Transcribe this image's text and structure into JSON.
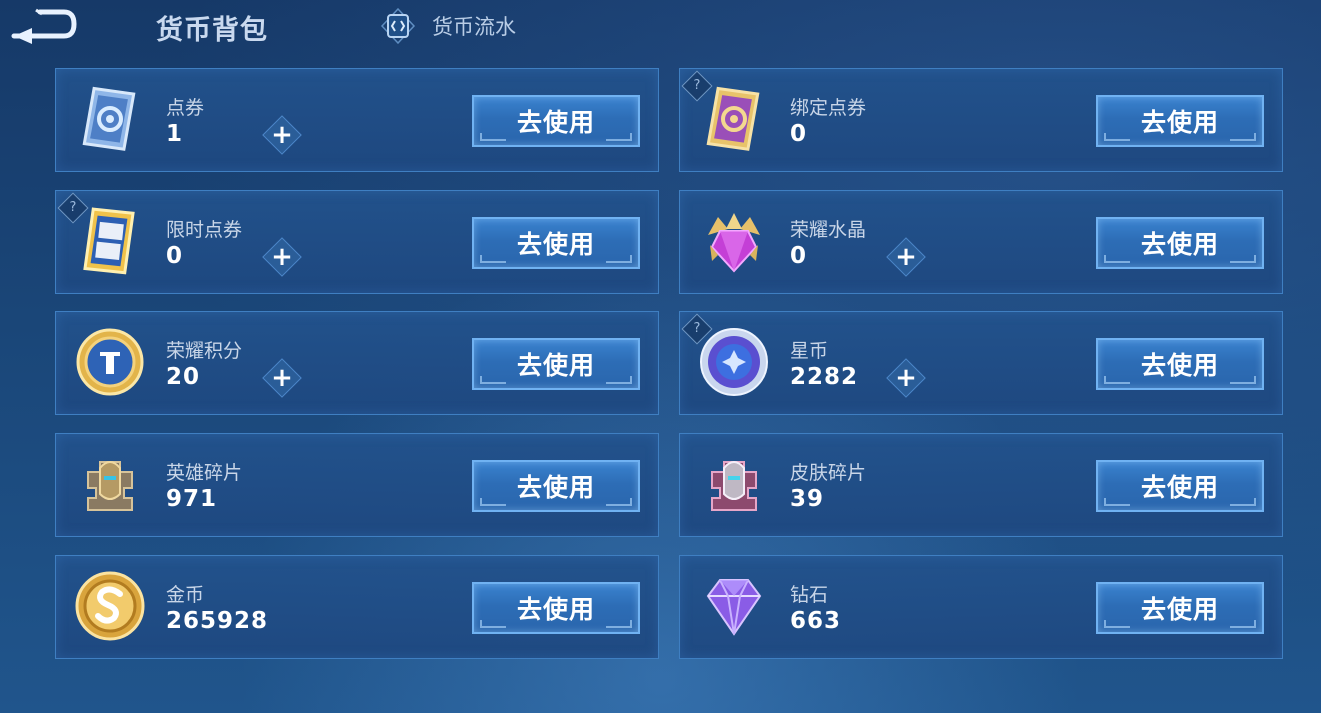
{
  "header": {
    "title": "货币背包",
    "flow_link": "货币流水"
  },
  "use_label": "去使用",
  "help_glyph": "?",
  "plus_glyph": "+",
  "currencies": [
    {
      "name": "点券",
      "value": "1",
      "icon": "ticket-blue-icon"
    },
    {
      "name": "绑定点券",
      "value": "0",
      "icon": "ticket-purple-icon"
    },
    {
      "name": "限时点券",
      "value": "0",
      "icon": "limited-ticket-icon"
    },
    {
      "name": "荣耀水晶",
      "value": "0",
      "icon": "glory-crystal-icon"
    },
    {
      "name": "荣耀积分",
      "value": "20",
      "icon": "glory-points-icon"
    },
    {
      "name": "星币",
      "value": "2282",
      "icon": "star-coin-icon"
    },
    {
      "name": "英雄碎片",
      "value": "971",
      "icon": "hero-fragment-icon"
    },
    {
      "name": "皮肤碎片",
      "value": "39",
      "icon": "skin-fragment-icon"
    },
    {
      "name": "金币",
      "value": "265928",
      "icon": "gold-coin-icon"
    },
    {
      "name": "钻石",
      "value": "663",
      "icon": "diamond-icon"
    }
  ],
  "colors": {
    "background": "#1a4678",
    "card": "#22528c",
    "card_border": "#3f7fc2",
    "button": "#2d6db6",
    "button_border": "#70b2f2"
  }
}
